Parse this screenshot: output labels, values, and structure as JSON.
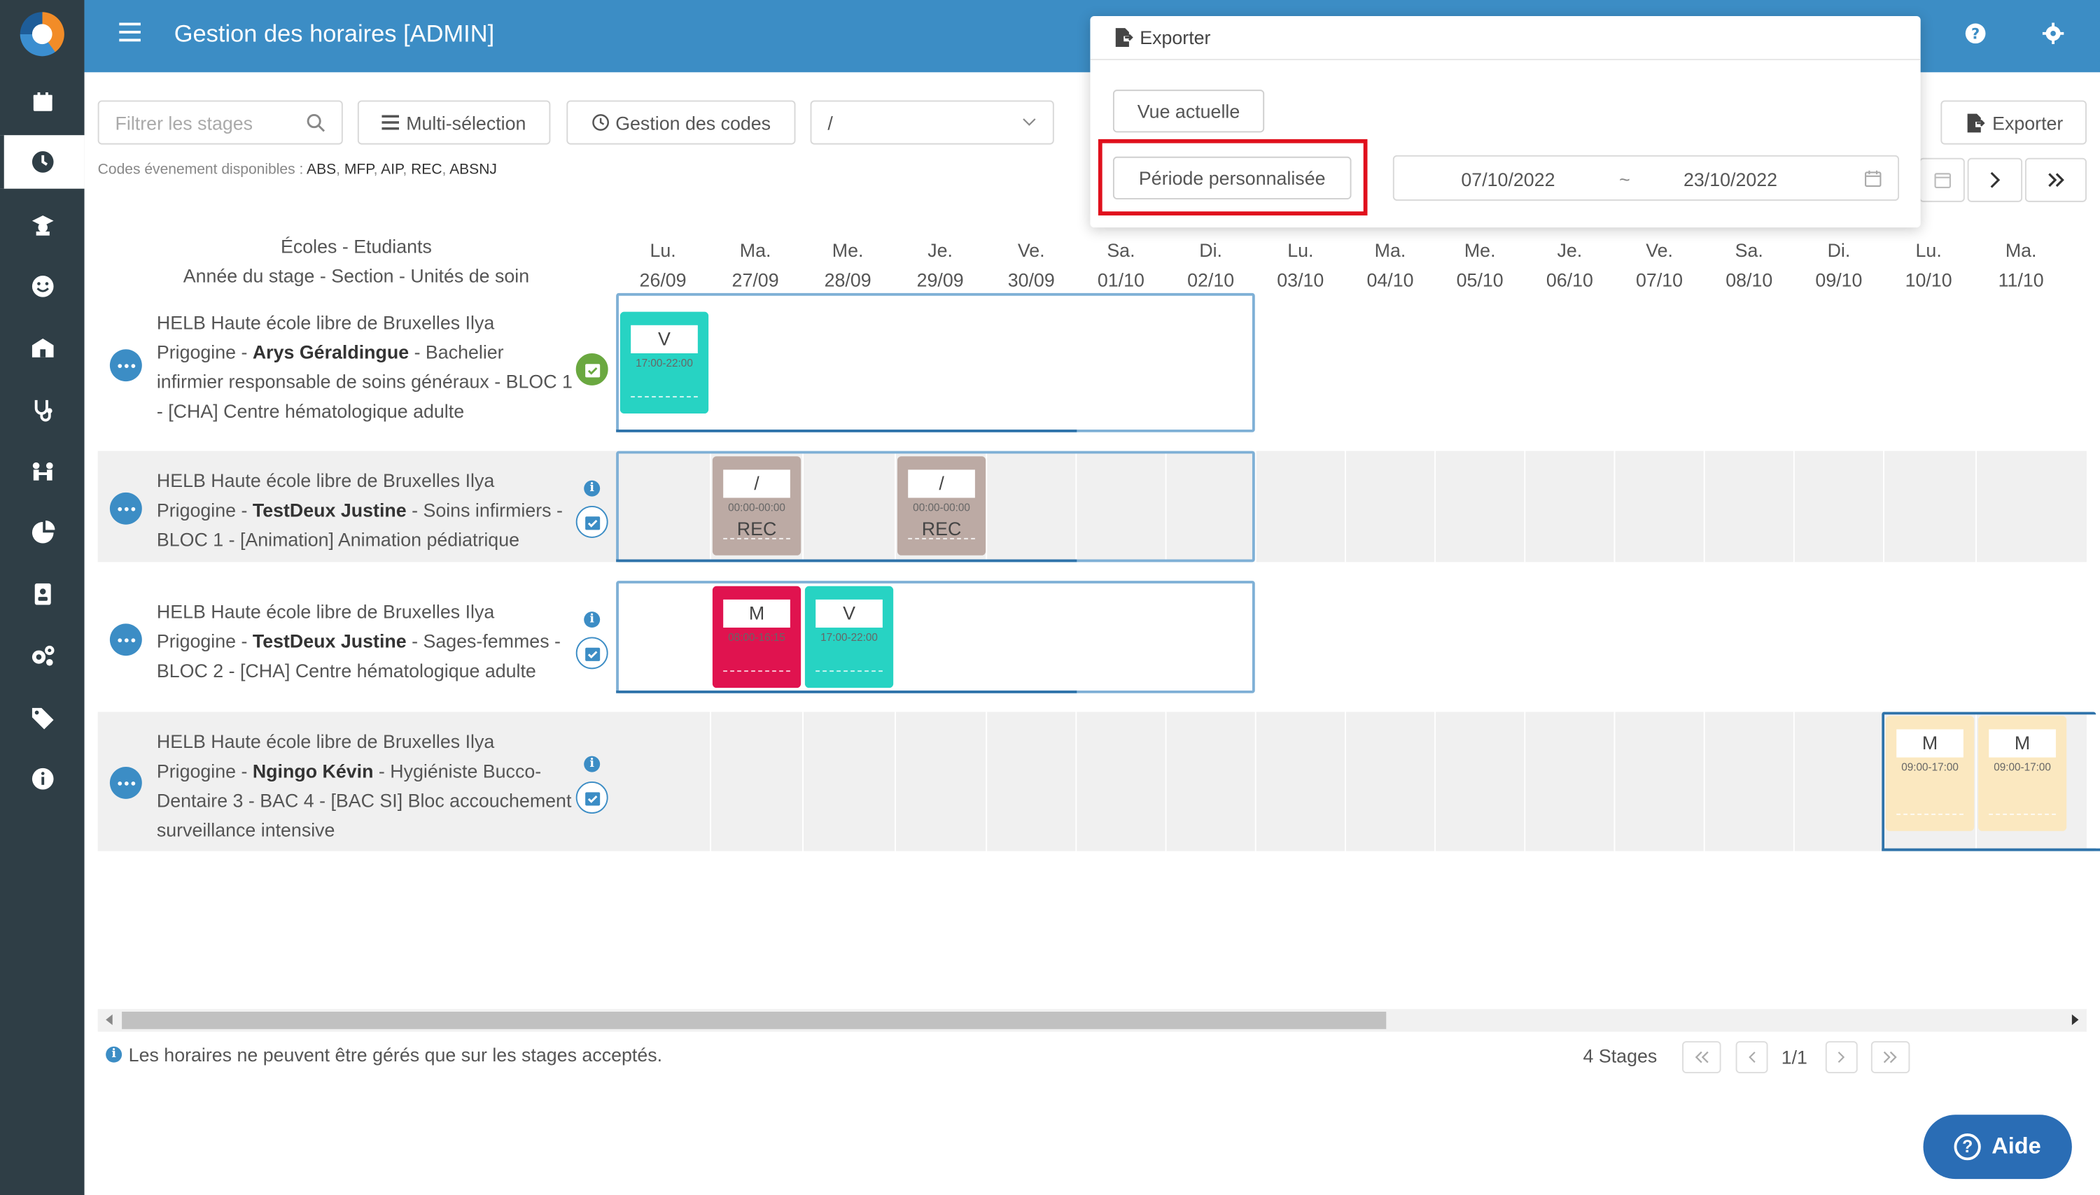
{
  "app": {
    "title": "Gestion des horaires [ADMIN]"
  },
  "toolbar": {
    "filter_placeholder": "Filtrer les stages",
    "multi_selection": "Multi-sélection",
    "code_management": "Gestion des codes",
    "select_value": "/",
    "codes_hint_label": "Codes évenement disponibles :",
    "codes": [
      "ABS",
      "MFP",
      "AIP",
      "REC",
      "ABSNJ"
    ],
    "export_label": "Exporter"
  },
  "export_panel": {
    "title": "Exporter",
    "current_view": "Vue actuelle",
    "custom_period": "Période personnalisée",
    "date_from": "07/10/2022",
    "date_sep": "~",
    "date_to": "23/10/2022"
  },
  "grid": {
    "header_line1": "Écoles - Etudiants",
    "header_line2": "Année du stage - Section - Unités de soin",
    "days": [
      {
        "d": "Lu.",
        "date": "26/09"
      },
      {
        "d": "Ma.",
        "date": "27/09"
      },
      {
        "d": "Me.",
        "date": "28/09"
      },
      {
        "d": "Je.",
        "date": "29/09"
      },
      {
        "d": "Ve.",
        "date": "30/09"
      },
      {
        "d": "Sa.",
        "date": "01/10"
      },
      {
        "d": "Di.",
        "date": "02/10"
      },
      {
        "d": "Lu.",
        "date": "03/10"
      },
      {
        "d": "Ma.",
        "date": "04/10"
      },
      {
        "d": "Me.",
        "date": "05/10"
      },
      {
        "d": "Je.",
        "date": "06/10"
      },
      {
        "d": "Ve.",
        "date": "07/10"
      },
      {
        "d": "Sa.",
        "date": "08/10"
      },
      {
        "d": "Di.",
        "date": "09/10"
      },
      {
        "d": "Lu.",
        "date": "10/10"
      },
      {
        "d": "Ma.",
        "date": "11/10"
      }
    ],
    "rows": [
      {
        "pre": "HELB Haute école libre de Bruxelles Ilya Prigogine - ",
        "name": "Arys Géraldingue",
        "post": " - Bachelier infirmier responsable de soins généraux - BLOC 1 - [CHA] Centre hématologique adulte"
      },
      {
        "pre": "HELB Haute école libre de Bruxelles Ilya Prigogine - ",
        "name": "TestDeux Justine",
        "post": " - Soins infirmiers - BLOC 1 - [Animation] Animation pédiatrique"
      },
      {
        "pre": "HELB Haute école libre de Bruxelles Ilya Prigogine - ",
        "name": "TestDeux Justine",
        "post": " - Sages-femmes - BLOC 2 - [CHA] Centre hématologique adulte"
      },
      {
        "pre": "HELB Haute école libre de Bruxelles Ilya Prigogine - ",
        "name": "Ngingo Kévin",
        "post": " - Hygiéniste Bucco-Dentaire 3 - BAC 4 - [BAC SI] Bloc accouchement surveillance intensive"
      }
    ],
    "shifts": [
      {
        "row": 0,
        "col": 0,
        "code": "V",
        "time": "17:00-22:00",
        "sub": "",
        "color": "#27d3c3"
      },
      {
        "row": 1,
        "col": 1,
        "code": "/",
        "time": "00:00-00:00",
        "sub": "REC",
        "color": "#bcaaa4"
      },
      {
        "row": 1,
        "col": 3,
        "code": "/",
        "time": "00:00-00:00",
        "sub": "REC",
        "color": "#bcaaa4"
      },
      {
        "row": 2,
        "col": 1,
        "code": "M",
        "time": "08:00-16:15",
        "sub": "",
        "color": "#e0134f"
      },
      {
        "row": 2,
        "col": 2,
        "code": "V",
        "time": "17:00-22:00",
        "sub": "",
        "color": "#27d3c3"
      },
      {
        "row": 3,
        "col": 14,
        "code": "M",
        "time": "09:00-17:00",
        "sub": "",
        "color": "#fbe8c0"
      },
      {
        "row": 3,
        "col": 15,
        "code": "M",
        "time": "09:00-17:00",
        "sub": "",
        "color": "#fbe8c0"
      }
    ]
  },
  "footer": {
    "note": "Les horaires ne peuvent être gérés que sur les stages acceptés.",
    "stages_count": "4 Stages",
    "page": "1/1"
  },
  "help": {
    "label": "Aide"
  },
  "colors": {
    "primary": "#3c8dc5",
    "sidebar": "#2f3e46",
    "highlight": "#e0101c"
  }
}
